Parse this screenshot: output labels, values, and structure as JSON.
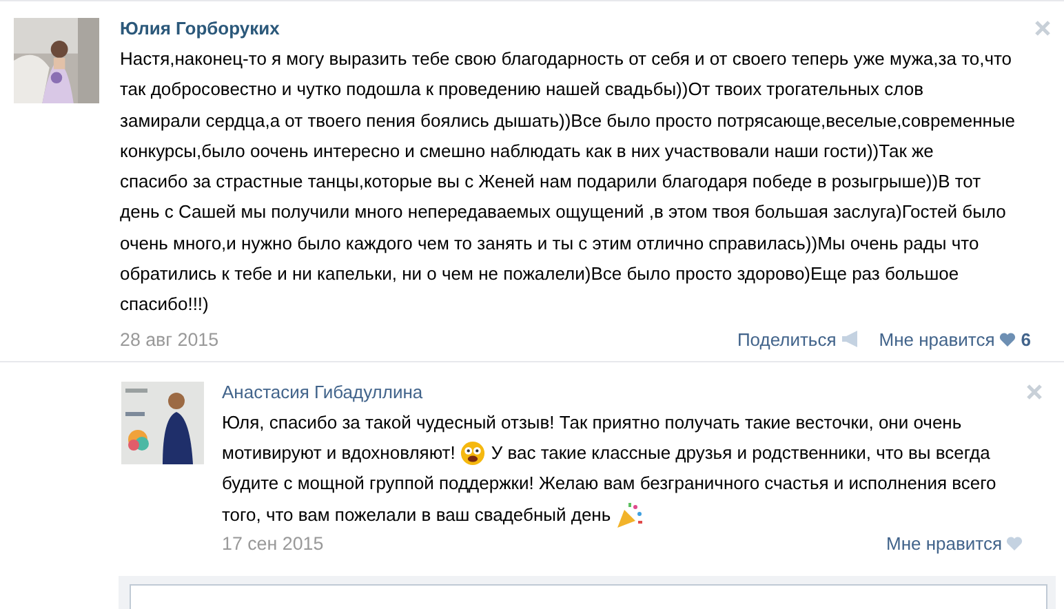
{
  "comment": {
    "author": "Юлия Горборуких",
    "lines": [
      [
        {
          "kind": "text",
          "text": "Настя,наконец-то я могу выразить тебе свою благодарность от себя и от своего теперь уже мужа,за то,что"
        }
      ],
      [
        {
          "kind": "text",
          "text": "так добросовестно и чутко подошла к проведению нашей свадьбы))От твоих трогательных слов"
        }
      ],
      [
        {
          "kind": "text",
          "text": "замирали сердца,а от твоего пения боялись дышать))Все было просто потрясающе,веселые,современные"
        }
      ],
      [
        {
          "kind": "text",
          "text": "конкурсы,было оочень интересно и смешно наблюдать как в них участвовали наши гости))Так же"
        }
      ],
      [
        {
          "kind": "text",
          "text": "спасибо за страстные танцы,которые вы с Женей нам подарили благодаря победе в розыгрыше))В тот"
        }
      ],
      [
        {
          "kind": "text",
          "text": "день с Сашей мы получили много непередаваемых ощущений ,в этом твоя большая заслуга)Гостей было"
        }
      ],
      [
        {
          "kind": "text",
          "text": "очень много,и нужно было каждого чем то занять и ты с этим отлично справилась))Мы очень рады что"
        }
      ],
      [
        {
          "kind": "text",
          "text": "обратились к тебе и ни капельки, ни о чем не пожалели)Все было просто здорово)Еще раз большое"
        }
      ],
      [
        {
          "kind": "text",
          "text": "спасибо!!!)"
        }
      ]
    ],
    "date": "28 авг 2015",
    "actions": [
      {
        "kind": "share",
        "label": "Поделиться"
      },
      {
        "kind": "like",
        "label": "Мне нравится",
        "count": "6"
      }
    ]
  },
  "reply": {
    "author": "Анастасия Гибадуллина",
    "lines": [
      [
        {
          "kind": "text",
          "text": "Юля, спасибо за такой чудесный отзыв! Так приятно получать такие весточки, они очень"
        }
      ],
      [
        {
          "kind": "text",
          "text": "мотивируют и вдохновляют!"
        },
        {
          "kind": "smiley"
        },
        {
          "kind": "text",
          "text": "У вас такие классные друзья и родственники, что вы всегда"
        }
      ],
      [
        {
          "kind": "text",
          "text": "будите с мощной группой поддержки! Желаю вам безграничного счастья и исполнения всего"
        }
      ],
      [
        {
          "kind": "text",
          "text": "того, что вам пожелали в ваш свадебный день"
        },
        {
          "kind": "party"
        }
      ]
    ],
    "date": "17 сен 2015",
    "actions": [
      {
        "kind": "like",
        "label": "Мне нравится"
      }
    ]
  }
}
